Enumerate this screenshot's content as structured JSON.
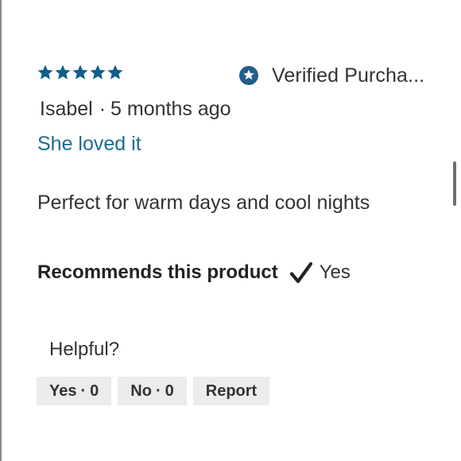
{
  "review": {
    "rating": 5,
    "rating_max": 5,
    "star_color": "#0f5f8c",
    "verified_label": "Verified Purcha...",
    "author": "Isabel",
    "separator": "·",
    "time_ago": "5 months ago",
    "title": "She loved it",
    "body": "Perfect for warm days and cool nights",
    "title_color": "#1f6b8e"
  },
  "recommends": {
    "label": "Recommends this product",
    "value": "Yes"
  },
  "helpful": {
    "label": "Helpful?",
    "yes_label": "Yes",
    "yes_count": "0",
    "no_label": "No",
    "no_count": "0",
    "report_label": "Report",
    "dot": "·"
  }
}
